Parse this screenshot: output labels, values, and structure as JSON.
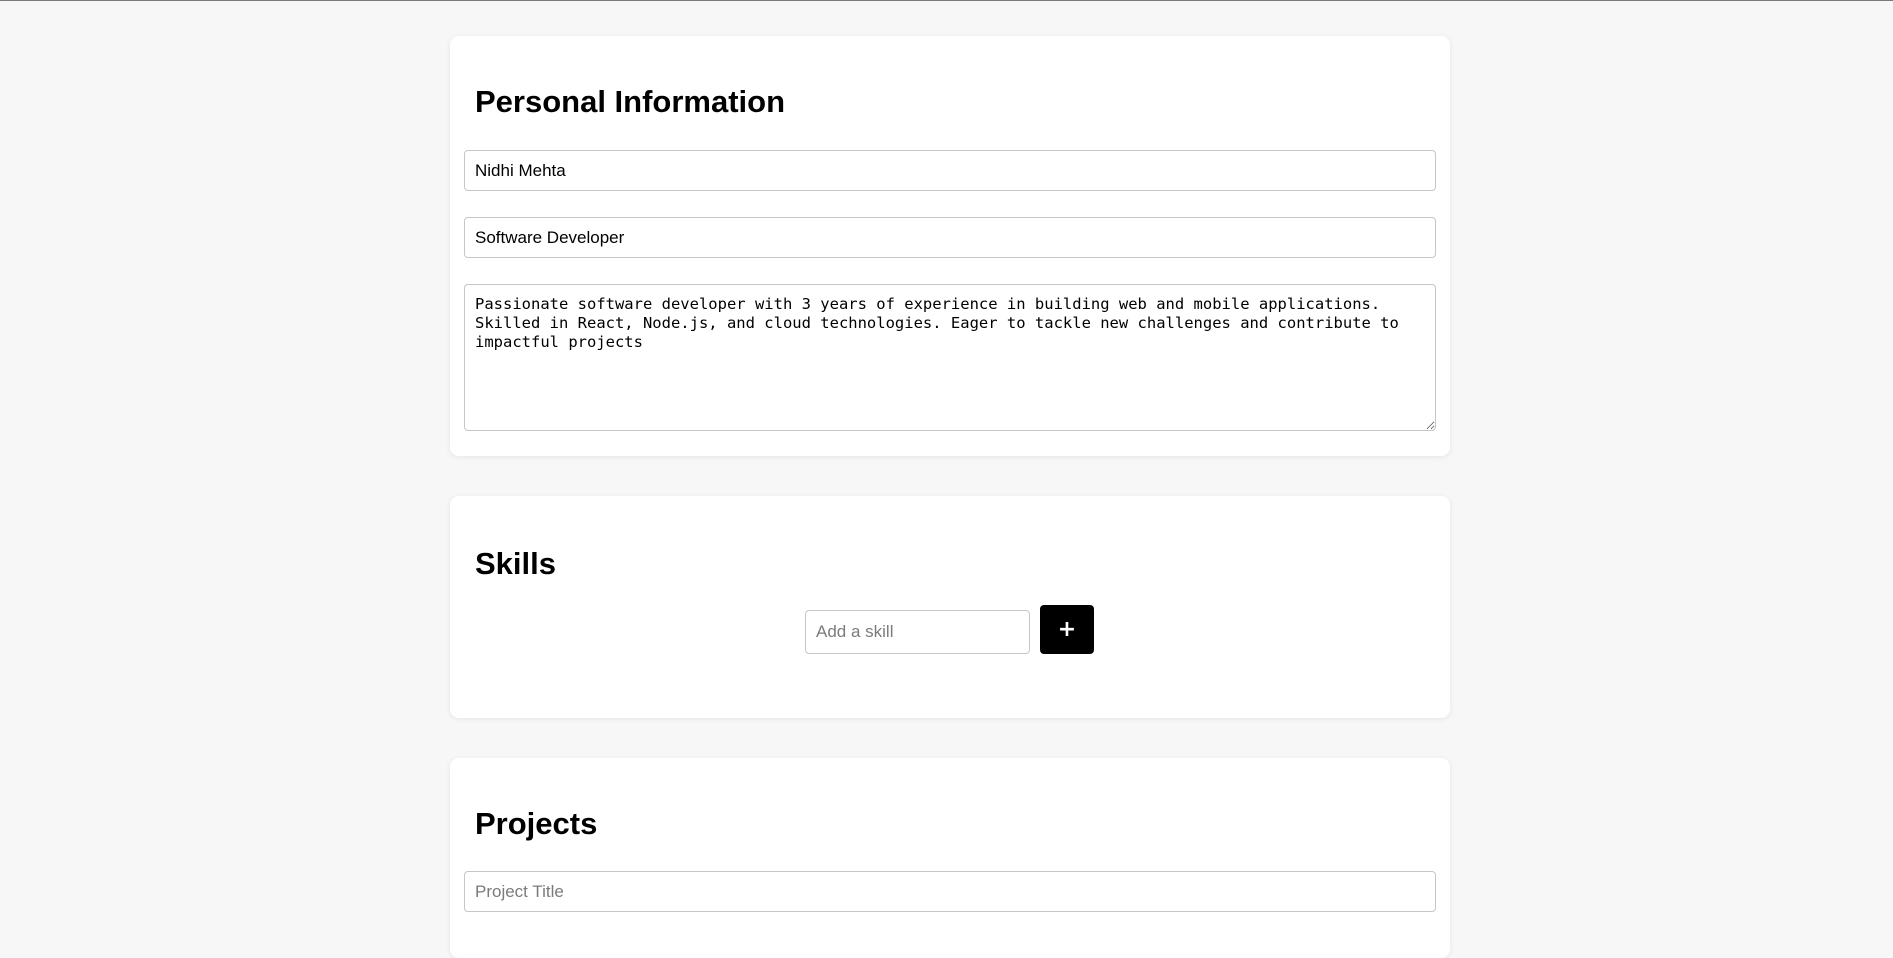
{
  "personal": {
    "title": "Personal Information",
    "name_value": "Nidhi Mehta",
    "role_value": "Software Developer",
    "bio_value": "Passionate software developer with 3 years of experience in building web and mobile applications. Skilled in React, Node.js, and cloud technologies. Eager to tackle new challenges and contribute to impactful projects"
  },
  "skills": {
    "title": "Skills",
    "input_placeholder": "Add a skill",
    "add_button_label": "+"
  },
  "projects": {
    "title": "Projects",
    "title_placeholder": "Project Title"
  }
}
